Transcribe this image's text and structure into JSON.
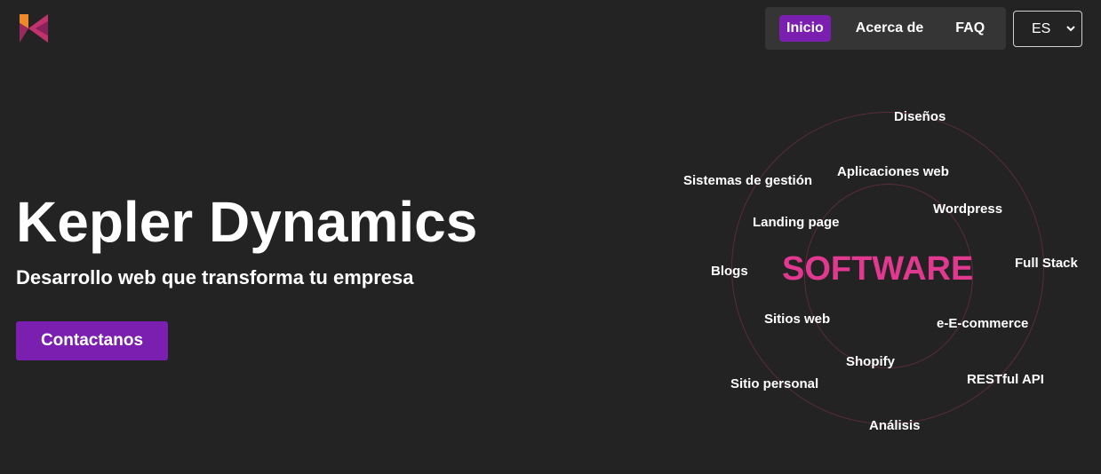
{
  "brand": {
    "logo_icon": "kepler-k-logo-icon",
    "colors": {
      "orange": "#f0892b",
      "magenta": "#c2336e",
      "purple": "#7b1fb0"
    }
  },
  "nav": {
    "items": [
      {
        "label": "Inicio",
        "active": true
      },
      {
        "label": "Acerca de",
        "active": false
      },
      {
        "label": "FAQ",
        "active": false
      }
    ]
  },
  "language": {
    "selected": "ES",
    "icon": "chevron-down-icon"
  },
  "hero": {
    "title": "Kepler Dynamics",
    "subtitle": "Desarrollo web que transforma tu empresa",
    "cta_label": "Contactanos"
  },
  "orbit": {
    "center": "SOFTWARE",
    "tags": [
      "Diseños",
      "Sistemas de gestión",
      "Aplicaciones web",
      "Landing page",
      "Wordpress",
      "Blogs",
      "Full Stack",
      "Sitios web",
      "e-E-commerce",
      "Shopify",
      "Sitio personal",
      "RESTful API",
      "Análisis"
    ]
  },
  "theme": {
    "background": "#232323",
    "nav_background": "#353535",
    "accent": "#7b1fb0",
    "highlight": "#e0398f"
  }
}
